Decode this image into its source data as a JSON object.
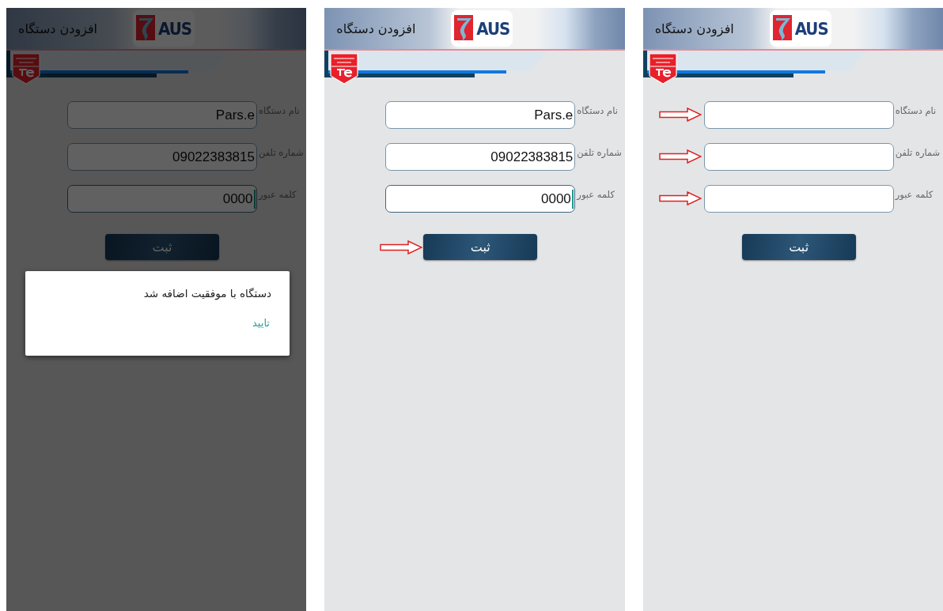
{
  "screen_left": {
    "title": "افزودن دستگاه",
    "logo_text": "AUS",
    "fields": [
      {
        "label": "نام دستگاه",
        "value": "Pars.e",
        "focused": false,
        "arrow": false
      },
      {
        "label": "شماره تلفن",
        "value": "09022383815",
        "focused": false,
        "arrow": false
      },
      {
        "label": "کلمه عبور",
        "value": "0000",
        "focused": true,
        "arrow": false
      }
    ],
    "submit": {
      "label": "ثبت",
      "arrow": false
    },
    "dialog": {
      "message": "دستگاه با موفقیت اضافه شد",
      "button": "تایید"
    }
  },
  "screen_middle": {
    "title": "افزودن دستگاه",
    "logo_text": "AUS",
    "fields": [
      {
        "label": "نام دستگاه",
        "value": "Pars.e",
        "focused": false,
        "arrow": false
      },
      {
        "label": "شماره تلفن",
        "value": "09022383815",
        "focused": false,
        "arrow": false
      },
      {
        "label": "کلمه عبور",
        "value": "0000",
        "focused": true,
        "arrow": false
      }
    ],
    "submit": {
      "label": "ثبت",
      "arrow": true
    }
  },
  "screen_right": {
    "title": "افزودن دستگاه",
    "logo_text": "AUS",
    "fields": [
      {
        "label": "نام دستگاه",
        "focused": false,
        "arrow": true
      },
      {
        "label": "شماره تلفن",
        "focused": false,
        "arrow": true
      },
      {
        "label": "کلمه عبور",
        "focused": false,
        "arrow": true
      }
    ],
    "submit": {
      "label": "ثبت",
      "arrow": false
    }
  }
}
